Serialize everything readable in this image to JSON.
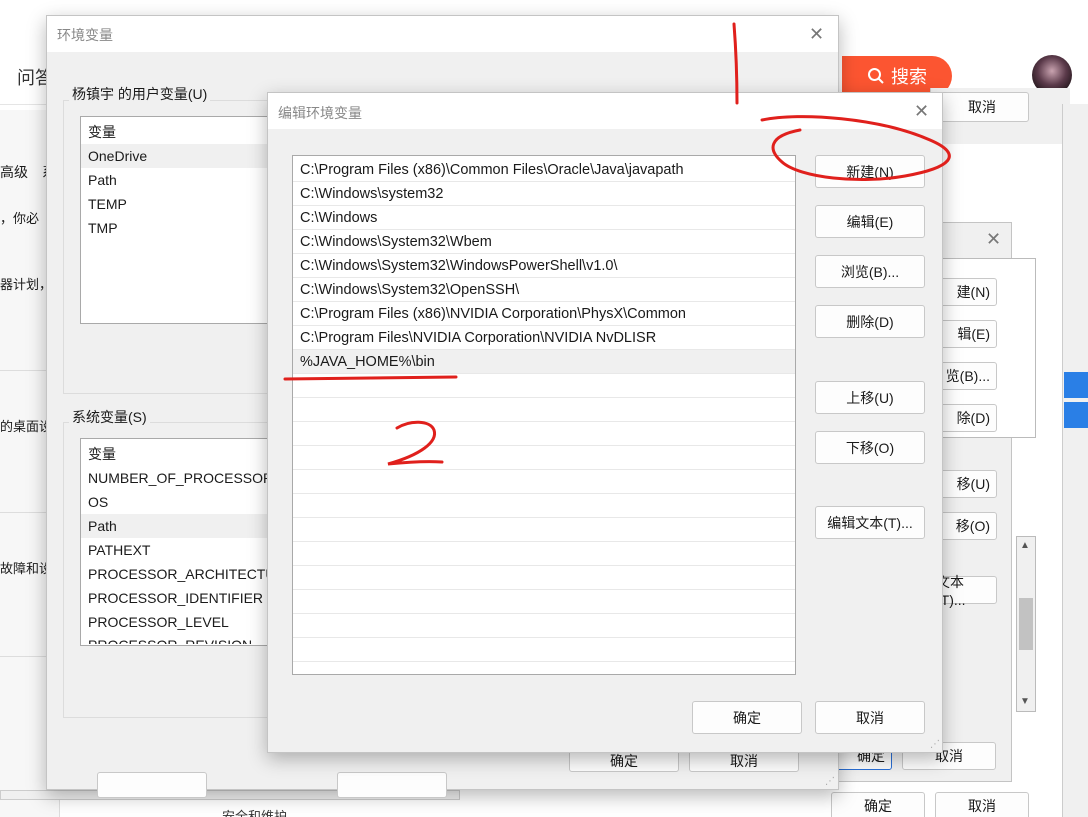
{
  "browser": {
    "tab_partial": "问答",
    "search_label": "搜索",
    "bg_label_gaoji": "高级",
    "bg_tab_partial": "系",
    "bg_text_1": "，你必",
    "bg_text_2": "器计划，",
    "bg_text_3": "的桌面设",
    "bg_text_4": "故障和设",
    "bg_bottom_text": "安全和维护",
    "bg_cancel_top": "取消"
  },
  "colors": {
    "search_button": "#fc5531",
    "annotation": "#e0201c"
  },
  "sys_props_behind": {
    "buttons": [
      "建(N)",
      "辑(E)",
      "览(B)...",
      "除(D)",
      "移(U)",
      "移(O)",
      "文本(T)..."
    ],
    "confirm": "确定",
    "cancel": "取消"
  },
  "env_dialog": {
    "title": "环境变量",
    "user_vars_label": "杨镇宇 的用户变量(U)",
    "user_vars_header": "变量",
    "user_vars": [
      "OneDrive",
      "Path",
      "TEMP",
      "TMP"
    ],
    "sys_vars_label": "系统变量(S)",
    "sys_vars_header": "变量",
    "sys_vars": [
      "NUMBER_OF_PROCESSORS",
      "OS",
      "Path",
      "PATHEXT",
      "PROCESSOR_ARCHITECTURE",
      "PROCESSOR_IDENTIFIER",
      "PROCESSOR_LEVEL",
      "PROCESSOR_REVISION"
    ],
    "confirm": "确定",
    "cancel": "取消"
  },
  "edit_dialog": {
    "title": "编辑环境变量",
    "paths": [
      "C:\\Program Files (x86)\\Common Files\\Oracle\\Java\\javapath",
      "C:\\Windows\\system32",
      "C:\\Windows",
      "C:\\Windows\\System32\\Wbem",
      "C:\\Windows\\System32\\WindowsPowerShell\\v1.0\\",
      "C:\\Windows\\System32\\OpenSSH\\",
      "C:\\Program Files (x86)\\NVIDIA Corporation\\PhysX\\Common",
      "C:\\Program Files\\NVIDIA Corporation\\NVIDIA NvDLISR",
      "%JAVA_HOME%\\bin"
    ],
    "buttons": {
      "new": "新建(N)",
      "edit": "编辑(E)",
      "browse": "浏览(B)...",
      "delete": "删除(D)",
      "move_up": "上移(U)",
      "move_down": "下移(O)",
      "edit_text": "编辑文本(T)...",
      "ok": "确定",
      "cancel": "取消"
    }
  },
  "annotations": {
    "mark_1": "1",
    "mark_2": "2"
  }
}
